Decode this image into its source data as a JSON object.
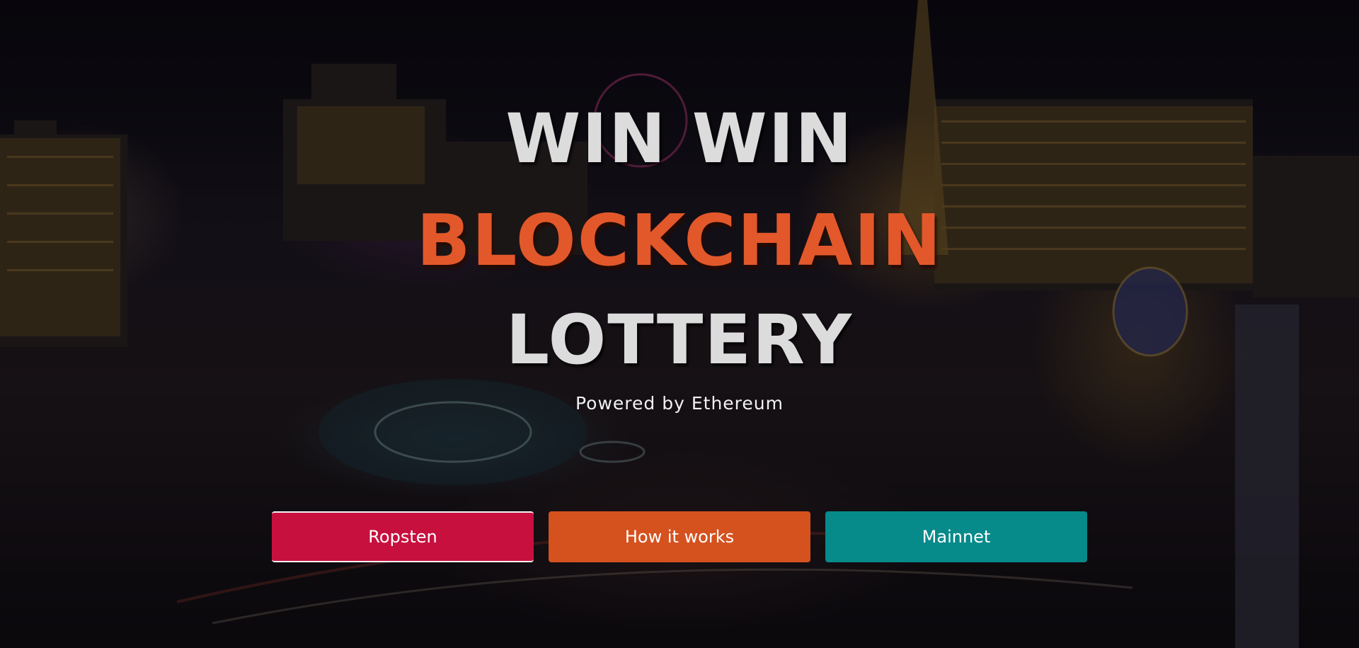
{
  "hero": {
    "title_line1": "WIN WIN",
    "title_line2": "BLOCKCHAIN",
    "title_line3": "LOTTERY",
    "subtitle": "Powered by Ethereum",
    "background_image": "las-vegas-strip-night"
  },
  "buttons": [
    {
      "label": "Ropsten",
      "color": "#c8103f"
    },
    {
      "label": "How it works",
      "color": "#d5521f"
    },
    {
      "label": "Mainnet",
      "color": "#068a8a"
    }
  ],
  "colors": {
    "accent": "#e2582a",
    "title_text": "#dcdcdc"
  }
}
